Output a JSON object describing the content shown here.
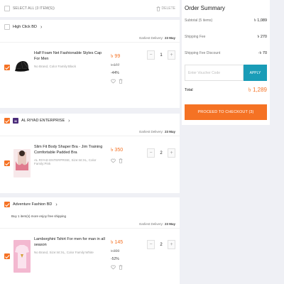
{
  "select_bar": {
    "label": "SELECT ALL (3 ITEM(S))",
    "delete_label": "DELETE"
  },
  "stores": [
    {
      "name": "High Click BD",
      "promo": "",
      "delivery_label": "Earliest Delivery:",
      "delivery_date": "23 May",
      "item": {
        "title": "Half Foam Net Fashionable Styles Cap For Men",
        "meta": "No Brand, Color Family:Black",
        "price": "৳ 99",
        "original_price": "৳ 177",
        "discount": "-44%",
        "quantity": "1"
      }
    },
    {
      "name": "AL RIYAD ENTERPRISE",
      "promo": "",
      "delivery_label": "Earliest Delivery:",
      "delivery_date": "23 May",
      "item": {
        "title": "Slim Fit Body Shaper Bra - Jim Training Comfortable Padded Bra",
        "meta": "AL RIYAD ENTERPRISE, Size:Int:XL, Color Family:Pink",
        "price": "৳ 350",
        "original_price": "",
        "discount": "",
        "quantity": "2"
      }
    },
    {
      "name": "Adventure Fashion BD",
      "promo": "Buy 1 item(s) more enjoy free shipping",
      "delivery_label": "Earliest Delivery:",
      "delivery_date": "23 May",
      "item": {
        "title": "Lamborghini Tshirt For men for man in all season",
        "meta": "No Brand, Size:Int:XL, Color Family:White",
        "price": "৳ 145",
        "original_price": "৳ 300",
        "discount": "-52%",
        "quantity": "2"
      }
    }
  ],
  "summary": {
    "title": "Order Summary",
    "subtotal_label": "Subtotal (5 items)",
    "subtotal_value": "৳ 1,089",
    "shipping_label": "Shipping Fee",
    "shipping_value": "৳ 270",
    "shipping_discount_label": "Shipping Fee Discount",
    "shipping_discount_value": "-৳ 70",
    "voucher_placeholder": "Enter Voucher Code",
    "apply_label": "APPLY",
    "total_label": "Total",
    "total_value": "৳ 1,289",
    "checkout_label": "PROCEED TO CHECKOUT (3)"
  },
  "colors": {
    "accent": "#f57224",
    "apply": "#1a9cb7",
    "background": "#eff0f5",
    "mall_badge": "#4a2b7a"
  },
  "icons": {
    "delete": "trash-icon",
    "wishlist": "heart-icon",
    "remove": "trash-icon",
    "store_nav": "chevron-right-icon"
  }
}
